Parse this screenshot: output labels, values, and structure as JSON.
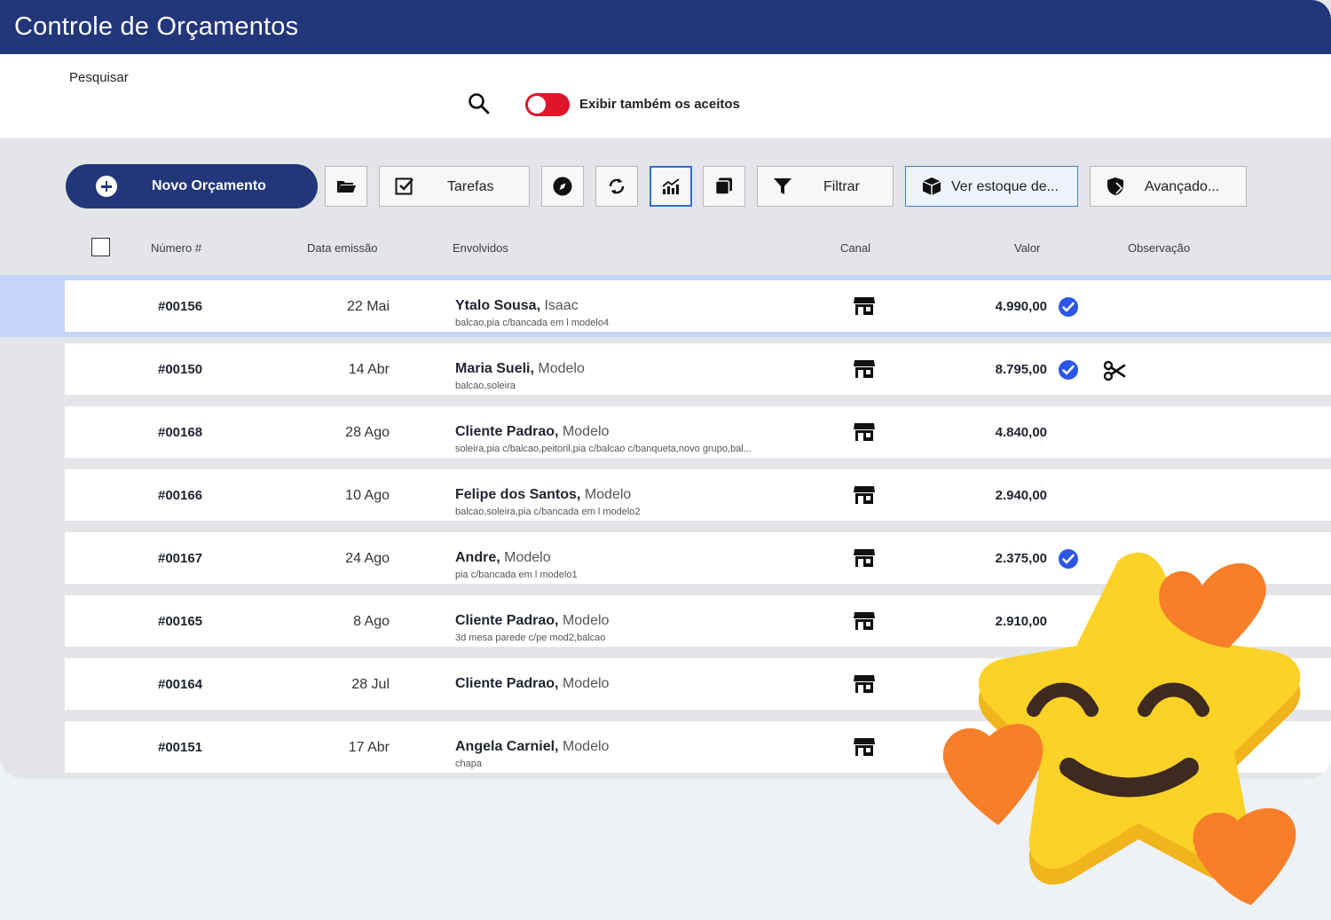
{
  "header": {
    "title": "Controle de Orçamentos"
  },
  "search": {
    "label": "Pesquisar",
    "value": "",
    "placeholder": ""
  },
  "toggle": {
    "label": "Exibir também os aceitos",
    "on": true
  },
  "toolbar": {
    "new_label": "Novo Orçamento",
    "tasks_label": "Tarefas",
    "filter_label": "Filtrar",
    "stock_label": "Ver estoque de...",
    "advanced_label": "Avançado..."
  },
  "columns": {
    "numero": "Número #",
    "data": "Data emissão",
    "envolvidos": "Envolvidos",
    "canal": "Canal",
    "valor": "Valor",
    "observacao": "Observação"
  },
  "rows": [
    {
      "numero": "#00156",
      "data": "22 Mai",
      "cliente": "Ytalo Sousa,",
      "vendedor": "Isaac",
      "itens": "balcao,pia c/bancada em l modelo4",
      "valor": "4.990,00",
      "aceito": true,
      "observacao": ""
    },
    {
      "numero": "#00150",
      "data": "14 Abr",
      "cliente": "Maria Sueli,",
      "vendedor": "Modelo",
      "itens": "balcao,soleira",
      "valor": "8.795,00",
      "aceito": true,
      "observacao": "scissors-icon"
    },
    {
      "numero": "#00168",
      "data": "28 Ago",
      "cliente": "Cliente Padrao,",
      "vendedor": "Modelo",
      "itens": "soleira,pia c/balcao,peitoril,pia c/balcao c/banqueta,novo grupo,bal...",
      "valor": "4.840,00",
      "aceito": false,
      "observacao": ""
    },
    {
      "numero": "#00166",
      "data": "10 Ago",
      "cliente": "Felipe dos Santos,",
      "vendedor": "Modelo",
      "itens": "balcao,soleira,pia c/bancada em l modelo2",
      "valor": "2.940,00",
      "aceito": false,
      "observacao": ""
    },
    {
      "numero": "#00167",
      "data": "24 Ago",
      "cliente": "Andre,",
      "vendedor": "Modelo",
      "itens": "pia c/bancada em l modelo1",
      "valor": "2.375,00",
      "aceito": true,
      "observacao": ""
    },
    {
      "numero": "#00165",
      "data": "8 Ago",
      "cliente": "Cliente Padrao,",
      "vendedor": "Modelo",
      "itens": "3d mesa parede c/pe mod2,balcao",
      "valor": "2.910,00",
      "aceito": false,
      "observacao": ""
    },
    {
      "numero": "#00164",
      "data": "28 Jul",
      "cliente": "Cliente Padrao,",
      "vendedor": "Modelo",
      "itens": "",
      "valor": "",
      "aceito": false,
      "observacao": ""
    },
    {
      "numero": "#00151",
      "data": "17 Abr",
      "cliente": "Angela Carniel,",
      "vendedor": "Modelo",
      "itens": "chapa",
      "valor": "",
      "aceito": false,
      "observacao": ""
    }
  ],
  "colors": {
    "header": "#22367a",
    "accent": "#2f6fd6",
    "toggle": "#e0142b",
    "check": "#2b56e6",
    "selected_row": "#c6d6f8"
  },
  "icons": {
    "canal": "store-icon",
    "aceito": "check-badge-icon"
  }
}
